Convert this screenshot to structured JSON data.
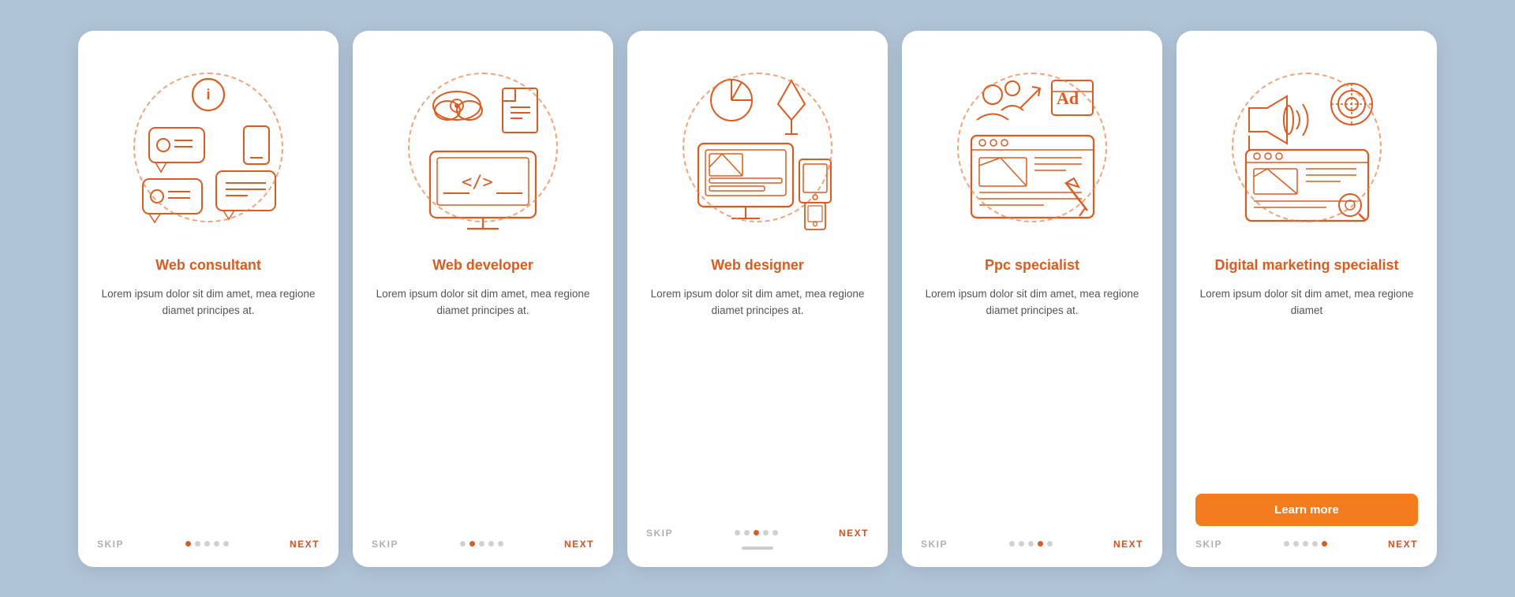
{
  "cards": [
    {
      "id": "web-consultant",
      "title": "Web consultant",
      "body": "Lorem ipsum dolor sit dim amet, mea regione diamet principes at.",
      "dots": [
        true,
        false,
        false,
        false,
        false
      ],
      "skip_label": "SKIP",
      "next_label": "NEXT",
      "show_learn_more": false,
      "show_scrollbar": false
    },
    {
      "id": "web-developer",
      "title": "Web developer",
      "body": "Lorem ipsum dolor sit dim amet, mea regione diamet principes at.",
      "dots": [
        false,
        true,
        false,
        false,
        false
      ],
      "skip_label": "SKIP",
      "next_label": "NEXT",
      "show_learn_more": false,
      "show_scrollbar": false
    },
    {
      "id": "web-designer",
      "title": "Web designer",
      "body": "Lorem ipsum dolor sit dim amet, mea regione diamet principes at.",
      "dots": [
        false,
        false,
        true,
        false,
        false
      ],
      "skip_label": "SKIP",
      "next_label": "NEXT",
      "show_learn_more": false,
      "show_scrollbar": true
    },
    {
      "id": "ppc-specialist",
      "title": "Ppc specialist",
      "body": "Lorem ipsum dolor sit dim amet, mea regione diamet principes at.",
      "dots": [
        false,
        false,
        false,
        true,
        false
      ],
      "skip_label": "SKIP",
      "next_label": "NEXT",
      "show_learn_more": false,
      "show_scrollbar": false
    },
    {
      "id": "digital-marketing",
      "title": "Digital marketing specialist",
      "body": "Lorem ipsum dolor sit dim amet, mea regione diamet",
      "dots": [
        false,
        false,
        false,
        false,
        true
      ],
      "skip_label": "SKIP",
      "next_label": "NEXT",
      "show_learn_more": true,
      "learn_more_label": "Learn more",
      "show_scrollbar": false
    }
  ],
  "accent_color": "#e05a1e",
  "orange_color": "#f47c1c"
}
